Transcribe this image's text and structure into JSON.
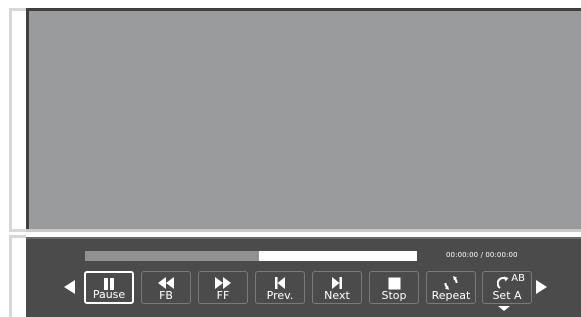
{
  "player": {
    "progress_fraction": 0.525,
    "time_text": "00:00:00 / 00:00:00"
  },
  "controls": [
    {
      "id": "pause",
      "label": "Pause",
      "icon": "pause-icon",
      "selected": true
    },
    {
      "id": "fb",
      "label": "FB",
      "icon": "fast-backward-icon",
      "selected": false
    },
    {
      "id": "ff",
      "label": "FF",
      "icon": "fast-forward-icon",
      "selected": false
    },
    {
      "id": "prev",
      "label": "Prev.",
      "icon": "skip-previous-icon",
      "selected": false
    },
    {
      "id": "next",
      "label": "Next",
      "icon": "skip-next-icon",
      "selected": false
    },
    {
      "id": "stop",
      "label": "Stop",
      "icon": "stop-icon",
      "selected": false
    },
    {
      "id": "repeat",
      "label": "Repeat",
      "icon": "repeat-icon",
      "selected": false
    },
    {
      "id": "seta",
      "label": "Set A",
      "icon": "ab-repeat-icon",
      "selected": false,
      "superscript": "AB"
    }
  ],
  "colors": {
    "video_bg": "#999b9c",
    "panel_bg": "#4b4b4b",
    "progress_fill": "#8f9193",
    "progress_track": "#ffffff"
  }
}
